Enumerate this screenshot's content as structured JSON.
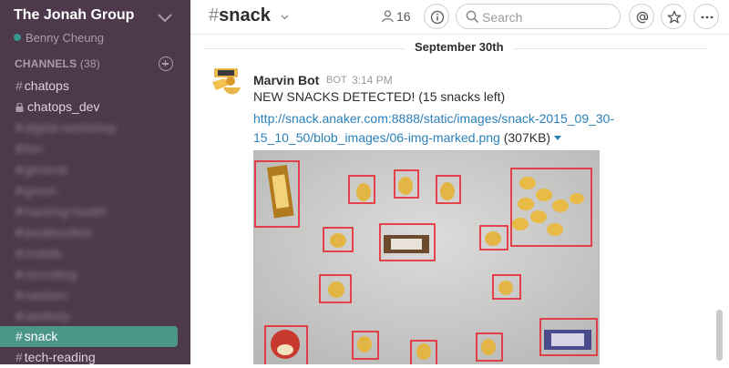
{
  "sidebar": {
    "team_name": "The Jonah Group",
    "user_name": "Benny Cheung",
    "channels_header": "CHANNELS",
    "channels_count": "(38)",
    "channels": [
      {
        "name": "chatops",
        "type": "public"
      },
      {
        "name": "chatops_dev",
        "type": "private"
      },
      {
        "name": "digital-workshop",
        "type": "public"
      },
      {
        "name": "fun",
        "type": "public"
      },
      {
        "name": "general",
        "type": "public"
      },
      {
        "name": "green",
        "type": "public"
      },
      {
        "name": "hacking-health",
        "type": "public"
      },
      {
        "name": "javaboutlets",
        "type": "public"
      },
      {
        "name": "mobile",
        "type": "public"
      },
      {
        "name": "recruiting",
        "type": "public"
      },
      {
        "name": "random",
        "type": "public"
      },
      {
        "name": "sitefinity",
        "type": "public"
      },
      {
        "name": "snack",
        "type": "public",
        "active": true
      },
      {
        "name": "tech-reading",
        "type": "public"
      }
    ]
  },
  "header": {
    "channel_name": "snack",
    "member_count": "16",
    "search_placeholder": "Search"
  },
  "messages": {
    "day_divider": "September 30th",
    "items": [
      {
        "sender": "Marvin Bot",
        "badge": "BOT",
        "time": "3:14 PM",
        "text": "NEW SNACKS DETECTED! (15 snacks left)",
        "link_line1": "http://snack.anaker.com:8888/static/images/snack-2015_09_30-",
        "link_line2": "15_10_50/blob_images/06-img-marked.png",
        "file_size": "(307KB)"
      }
    ]
  },
  "colors": {
    "sidebar_bg": "#4d394b",
    "active_channel": "#4c9689",
    "link": "#2a80b9",
    "detection_box": "#e8202a"
  },
  "icons": [
    "chevron-down-icon",
    "presence-dot-icon",
    "plus-circle-icon",
    "lock-icon",
    "member-icon",
    "info-icon",
    "search-icon",
    "at-icon",
    "star-icon",
    "more-icon",
    "bot-avatar-icon"
  ]
}
